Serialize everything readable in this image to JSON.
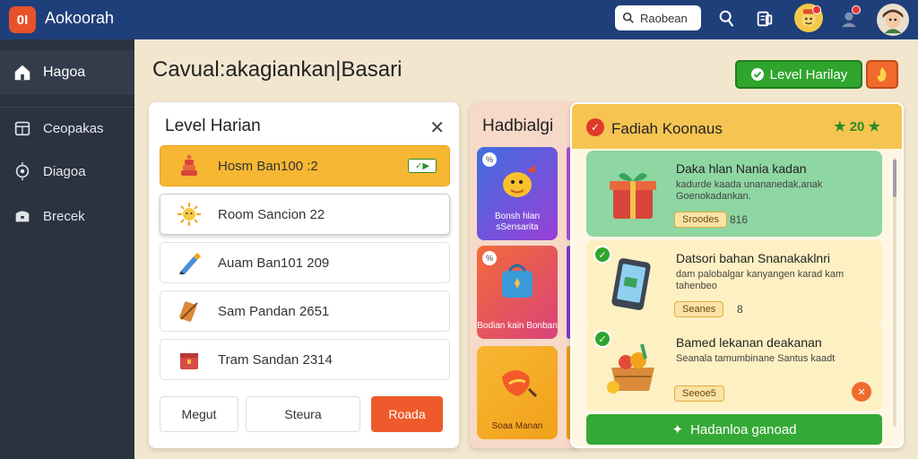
{
  "app": {
    "logo": "0I",
    "name": "Aokoorah"
  },
  "search": {
    "value": "Raobean"
  },
  "sidebar": {
    "items": [
      {
        "label": "Hagoa",
        "icon": "home-icon"
      },
      {
        "label": "Ceopakas",
        "icon": "calendar-icon"
      },
      {
        "label": "Diagoa",
        "icon": "badge-icon"
      },
      {
        "label": "Brecek",
        "icon": "chest-icon"
      }
    ]
  },
  "page": {
    "title": "Cavual:akagiankan|Basari"
  },
  "actions": {
    "level_button": "Level Harilay"
  },
  "level_panel": {
    "title": "Level Harian",
    "items": [
      {
        "label": "Hosm Ban100 :2",
        "icon": "cake-icon"
      },
      {
        "label": "Room Sancion 22",
        "icon": "sun-icon"
      },
      {
        "label": "Auam Ban101 209",
        "icon": "pencil-icon"
      },
      {
        "label": "Sam Pandan 2651",
        "icon": "scroll-icon"
      },
      {
        "label": "Tram Sandan 2314",
        "icon": "box-icon"
      }
    ],
    "buttons": {
      "first": "Megut",
      "second": "Steura",
      "third": "Roada"
    }
  },
  "rewards": {
    "title": "Hadbialgi",
    "cards": [
      {
        "label": "Bonsh hlan sSensarita",
        "badge": "%",
        "icon": "duck-icon"
      },
      {
        "label": "Bodian kain Bonban",
        "badge": "%",
        "icon": "bag-icon"
      },
      {
        "label": "Soaa Manan",
        "badge": "",
        "icon": "fruit-icon"
      }
    ]
  },
  "gifts": {
    "title": "Fadiah Koonaus",
    "score": "20",
    "cards": [
      {
        "title": "Daka hlan Nania kadan",
        "desc": "kadurde kaada unananedak,anak Goenokadankan.",
        "pill": "Sroodes",
        "value": "816",
        "icon": "gift-box-icon"
      },
      {
        "title": "Datsori bahan Snanakaklnri",
        "desc": "dam palobalgar kanyangen karad kam tahenbeo",
        "pill": "Seanes",
        "value": "8",
        "icon": "tablet-icon"
      },
      {
        "title": "Bamed lekanan deakanan",
        "desc": "Seanala tamumbinane Santus kaadt",
        "pill": "Seeoe5",
        "value": "",
        "icon": "fruit-basket-icon"
      }
    ],
    "cta": "Hadanloa ganoad"
  }
}
